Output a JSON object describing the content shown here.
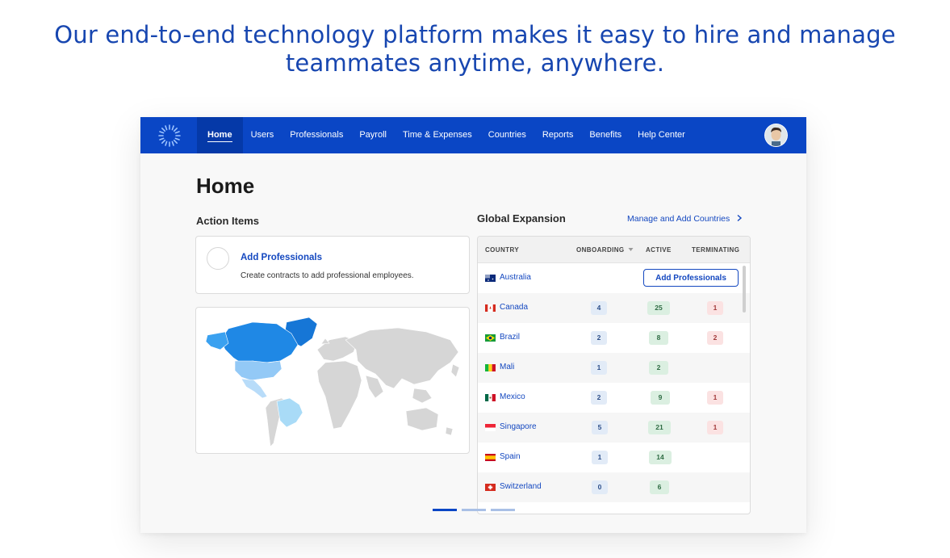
{
  "headline": {
    "line1": "Our end-to-end technology platform makes it easy to hire and manage",
    "line2": "teammates anytime, anywhere."
  },
  "colors": {
    "brand_blue": "#0a46c5",
    "headline_blue": "#1746b0",
    "link_blue": "#1448c0"
  },
  "carousel": {
    "prev_icon": "chevron-left-icon",
    "next_icon": "chevron-right-icon",
    "slides": 3,
    "active_slide": 1
  },
  "app": {
    "logo_icon": "sunburst-logo-icon",
    "nav": [
      {
        "label": "Home",
        "active": true
      },
      {
        "label": "Users"
      },
      {
        "label": "Professionals"
      },
      {
        "label": "Payroll"
      },
      {
        "label": "Time & Expenses"
      },
      {
        "label": "Countries"
      },
      {
        "label": "Reports"
      },
      {
        "label": "Benefits"
      },
      {
        "label": "Help Center"
      }
    ],
    "avatar_icon": "user-avatar-icon",
    "page_title": "Home",
    "action_items": {
      "title": "Action Items",
      "card_title": "Add Professionals",
      "card_desc": "Create contracts to add professional employees."
    },
    "global_expansion": {
      "title": "Global Expansion",
      "link": "Manage and Add Countries",
      "link_icon": "chevron-right-icon",
      "columns": [
        "COUNTRY",
        "ONBOARDING",
        "ACTIVE",
        "TERMINATING"
      ],
      "sort_icon": "sort-down-icon",
      "add_button": "Add Professionals",
      "rows": [
        {
          "country": "Australia",
          "onboarding": "",
          "active": "",
          "terminating": ""
        },
        {
          "country": "Canada",
          "onboarding": "4",
          "active": "25",
          "terminating": "1"
        },
        {
          "country": "Brazil",
          "onboarding": "2",
          "active": "8",
          "terminating": "2"
        },
        {
          "country": "Mali",
          "onboarding": "1",
          "active": "2",
          "terminating": ""
        },
        {
          "country": "Mexico",
          "onboarding": "2",
          "active": "9",
          "terminating": "1"
        },
        {
          "country": "Singapore",
          "onboarding": "5",
          "active": "21",
          "terminating": "1"
        },
        {
          "country": "Spain",
          "onboarding": "1",
          "active": "14",
          "terminating": ""
        },
        {
          "country": "Switzerland",
          "onboarding": "0",
          "active": "6",
          "terminating": ""
        }
      ]
    }
  }
}
